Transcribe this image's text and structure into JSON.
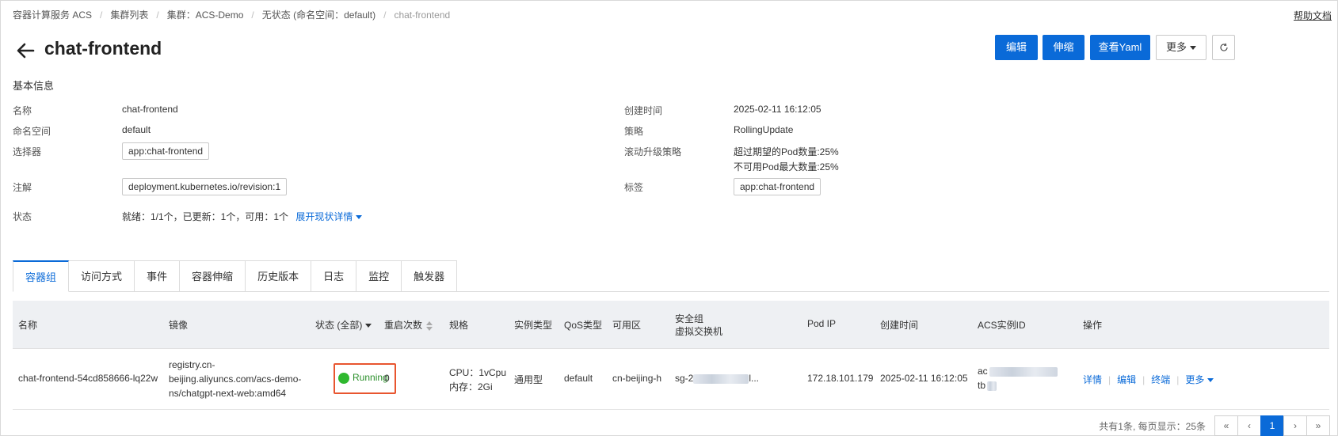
{
  "breadcrumb": {
    "items": [
      "容器计算服务 ACS",
      "集群列表",
      "集群：ACS-Demo",
      "无状态 (命名空间：default)"
    ],
    "current": "chat-frontend"
  },
  "help_link": "帮助文档",
  "header": {
    "title": "chat-frontend",
    "buttons": {
      "edit": "编辑",
      "scale": "伸缩",
      "view_yaml": "查看Yaml",
      "more": "更多"
    }
  },
  "basic_info": {
    "section_title": "基本信息",
    "left": {
      "name_label": "名称",
      "name_value": "chat-frontend",
      "namespace_label": "命名空间",
      "namespace_value": "default",
      "selector_label": "选择器",
      "selector_value": "app:chat-frontend",
      "annotation_label": "注解",
      "annotation_value": "deployment.kubernetes.io/revision:1",
      "status_label": "状态",
      "status_value": "就绪：1/1个，已更新：1个，可用：1个",
      "status_expand": "展开现状详情"
    },
    "right": {
      "created_label": "创建时间",
      "created_value": "2025-02-11 16:12:05",
      "strategy_label": "策略",
      "strategy_value": "RollingUpdate",
      "rolling_label": "滚动升级策略",
      "rolling_line1": "超过期望的Pod数量:25%",
      "rolling_line2": "不可用Pod最大数量:25%",
      "tag_label": "标签",
      "tag_value": "app:chat-frontend"
    }
  },
  "tabs": [
    "容器组",
    "访问方式",
    "事件",
    "容器伸缩",
    "历史版本",
    "日志",
    "监控",
    "触发器"
  ],
  "table": {
    "headers": {
      "name": "名称",
      "image": "镜像",
      "status": "状态 (全部)",
      "restarts": "重启次数",
      "spec": "规格",
      "instance_type": "实例类型",
      "qos": "QoS类型",
      "zone": "可用区",
      "sg_line1": "安全组",
      "sg_line2": "虚拟交换机",
      "pod_ip": "Pod IP",
      "created": "创建时间",
      "acs_id": "ACS实例ID",
      "ops": "操作"
    },
    "row": {
      "name": "chat-frontend-54cd858666-lq22w",
      "image_line1": "registry.cn-",
      "image_line2": "beijing.aliyuncs.com/acs-demo-",
      "image_line3": "ns/chatgpt-next-web:amd64",
      "status": "Running",
      "restarts": "0",
      "spec_cpu": "CPU：1vCpu",
      "spec_mem": "内存：2Gi",
      "instance_type": "通用型",
      "qos": "default",
      "zone": "cn-beijing-h",
      "sg_prefix": "sg-2",
      "sg_suffix": "l...",
      "pod_ip": "172.18.101.179",
      "created": "2025-02-11 16:12:05",
      "acs_prefix1": "ac",
      "acs_prefix2": "tb",
      "ops": {
        "detail": "详情",
        "edit": "编辑",
        "terminal": "终端",
        "more": "更多"
      }
    }
  },
  "pagination": {
    "info": "共有1条, 每页显示：25条",
    "first": "«",
    "prev": "‹",
    "current": "1",
    "next": "›",
    "last": "»"
  },
  "colors": {
    "primary": "#0a6ad8",
    "running": "#2fb82f",
    "highlight": "#e8552f"
  }
}
